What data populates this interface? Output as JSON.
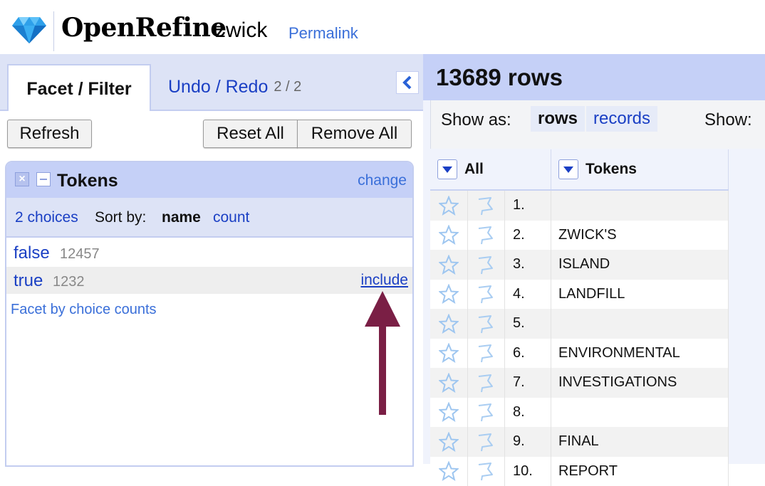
{
  "header": {
    "logo_text": "OpenRefine",
    "project_name": "zwick",
    "permalink_label": "Permalink"
  },
  "left_panel": {
    "tabs": [
      {
        "label": "Facet / Filter"
      },
      {
        "label": "Undo / Redo",
        "count": "2 / 2"
      }
    ],
    "buttons": {
      "refresh": "Refresh",
      "reset_all": "Reset All",
      "remove_all": "Remove All"
    },
    "facet": {
      "name": "Tokens",
      "change_label": "change",
      "choices_count": "2 choices",
      "sort_by_label": "Sort by:",
      "sort_name": "name",
      "sort_count": "count",
      "choices": [
        {
          "name": "false",
          "count": "12457"
        },
        {
          "name": "true",
          "count": "1232",
          "action": "include"
        }
      ],
      "facet_by_choice_counts": "Facet by choice counts"
    }
  },
  "right_panel": {
    "row_count": "13689 rows",
    "show_as_label": "Show as:",
    "modes": {
      "rows": "rows",
      "records": "records"
    },
    "show_label": "Show:",
    "columns": [
      "All",
      "Tokens"
    ],
    "rows": [
      {
        "index": "1.",
        "token": ""
      },
      {
        "index": "2.",
        "token": "ZWICK'S"
      },
      {
        "index": "3.",
        "token": "ISLAND"
      },
      {
        "index": "4.",
        "token": "LANDFILL"
      },
      {
        "index": "5.",
        "token": ""
      },
      {
        "index": "6.",
        "token": "ENVIRONMENTAL"
      },
      {
        "index": "7.",
        "token": "INVESTIGATIONS"
      },
      {
        "index": "8.",
        "token": ""
      },
      {
        "index": "9.",
        "token": "FINAL"
      },
      {
        "index": "10.",
        "token": "REPORT"
      }
    ]
  },
  "colors": {
    "accent_blue": "#1a3fc4",
    "panel_blue": "#c5d0f7",
    "arrow": "#7a1f45"
  }
}
